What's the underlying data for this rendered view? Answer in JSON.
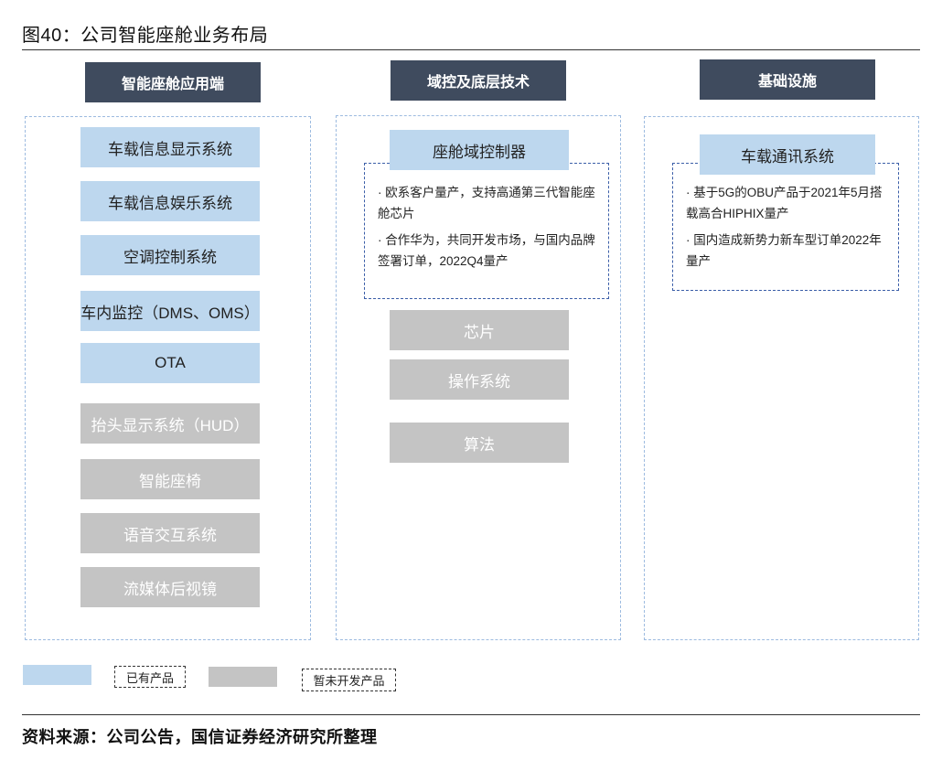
{
  "figure_title": "图40：公司智能座舱业务布局",
  "columns": {
    "app": {
      "header": "智能座舱应用端"
    },
    "domain": {
      "header": "域控及底层技术"
    },
    "infra": {
      "header": "基础设施"
    }
  },
  "app_items": [
    {
      "label": "车载信息显示系统",
      "status": "existing"
    },
    {
      "label": "车载信息娱乐系统",
      "status": "existing"
    },
    {
      "label": "空调控制系统",
      "status": "existing"
    },
    {
      "label": "车内监控（DMS、OMS）",
      "status": "existing"
    },
    {
      "label": "OTA",
      "status": "existing"
    },
    {
      "label": "抬头显示系统（HUD）",
      "status": "planned"
    },
    {
      "label": "智能座椅",
      "status": "planned"
    },
    {
      "label": "语音交互系统",
      "status": "planned"
    },
    {
      "label": "流媒体后视镜",
      "status": "planned"
    }
  ],
  "domain_controller": {
    "label": "座舱域控制器",
    "notes": [
      "· 欧系客户量产，支持高通第三代智能座舱芯片",
      "· 合作华为，共同开发市场，与国内品牌签署订单，2022Q4量产"
    ]
  },
  "domain_items": [
    {
      "label": "芯片",
      "status": "planned"
    },
    {
      "label": "操作系统",
      "status": "planned"
    },
    {
      "label": "算法",
      "status": "planned"
    }
  ],
  "comm_system": {
    "label": "车载通讯系统",
    "notes": [
      "· 基于5G的OBU产品于2021年5月搭载高合HIPHIX量产",
      "· 国内造成新势力新车型订单2022年量产"
    ]
  },
  "legend": {
    "existing": "已有产品",
    "planned": "暂未开发产品"
  },
  "colors": {
    "existing": "#bdd7ee",
    "planned": "#c4c4c4",
    "header": "#3f4b5e",
    "panel_border": "#9dbbe0",
    "note_border": "#3b5ea8"
  },
  "source": "资料来源：公司公告，国信证券经济研究所整理"
}
